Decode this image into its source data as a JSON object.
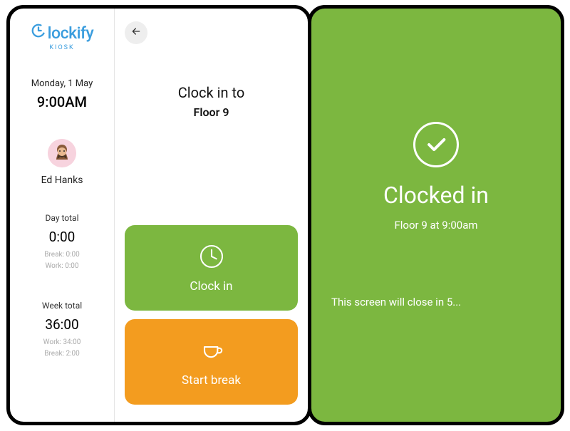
{
  "brand": {
    "name": "lockify",
    "kiosk": "KIOSK"
  },
  "sidebar": {
    "date": "Monday, 1 May",
    "time": "9:00AM",
    "user_name": "Ed Hanks",
    "day": {
      "label": "Day total",
      "value": "0:00",
      "break": "Break: 0:00",
      "work": "Work: 0:00"
    },
    "week": {
      "label": "Week total",
      "value": "36:00",
      "work": "Work: 34:00",
      "break": "Break: 2:00"
    }
  },
  "main": {
    "prompt_title": "Clock in to",
    "prompt_location": "Floor 9",
    "clock_in_label": "Clock in",
    "start_break_label": "Start break"
  },
  "confirm": {
    "title": "Clocked in",
    "detail": "Floor 9 at 9:00am",
    "close_note": "This screen will close in 5..."
  },
  "colors": {
    "accent_blue": "#3a9dde",
    "green": "#7cb740",
    "orange": "#f39c1f"
  }
}
